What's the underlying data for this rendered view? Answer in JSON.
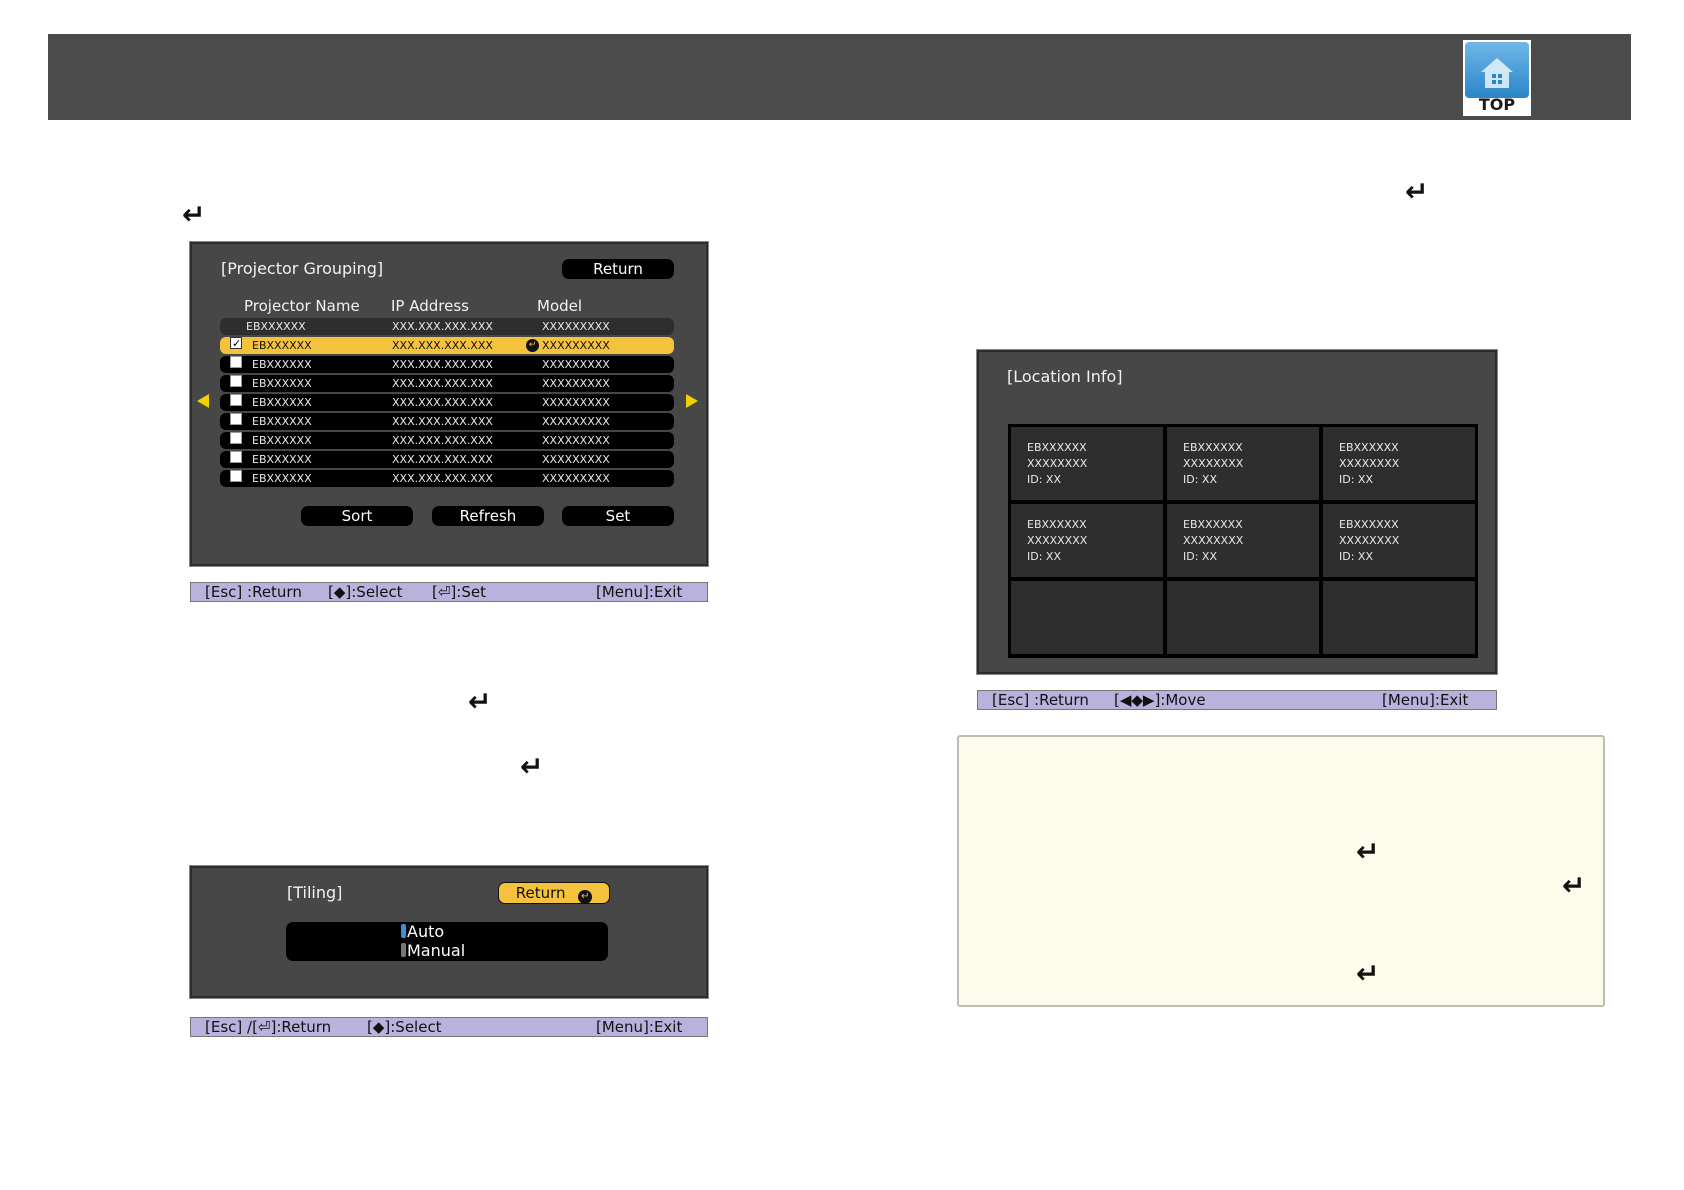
{
  "header": {
    "logo_label": "TOP"
  },
  "projector_grouping": {
    "title": "[Projector Grouping]",
    "return_label": "Return",
    "columns": [
      "Projector Name",
      "IP Address",
      "Model"
    ],
    "rows": [
      {
        "name": "EBXXXXXX",
        "ip": "XXX.XXX.XXX.XXX",
        "model": "XXXXXXXXX",
        "checked": false,
        "selected": false
      },
      {
        "name": "EBXXXXXX",
        "ip": "XXX.XXX.XXX.XXX",
        "model": "XXXXXXXXX",
        "checked": true,
        "selected": true
      },
      {
        "name": "EBXXXXXX",
        "ip": "XXX.XXX.XXX.XXX",
        "model": "XXXXXXXXX",
        "checked": false,
        "selected": false
      },
      {
        "name": "EBXXXXXX",
        "ip": "XXX.XXX.XXX.XXX",
        "model": "XXXXXXXXX",
        "checked": false,
        "selected": false
      },
      {
        "name": "EBXXXXXX",
        "ip": "XXX.XXX.XXX.XXX",
        "model": "XXXXXXXXX",
        "checked": false,
        "selected": false
      },
      {
        "name": "EBXXXXXX",
        "ip": "XXX.XXX.XXX.XXX",
        "model": "XXXXXXXXX",
        "checked": false,
        "selected": false
      },
      {
        "name": "EBXXXXXX",
        "ip": "XXX.XXX.XXX.XXX",
        "model": "XXXXXXXXX",
        "checked": false,
        "selected": false
      },
      {
        "name": "EBXXXXXX",
        "ip": "XXX.XXX.XXX.XXX",
        "model": "XXXXXXXXX",
        "checked": false,
        "selected": false
      },
      {
        "name": "EBXXXXXX",
        "ip": "XXX.XXX.XXX.XXX",
        "model": "XXXXXXXXX",
        "checked": false,
        "selected": false
      }
    ],
    "sort_label": "Sort",
    "refresh_label": "Refresh",
    "set_label": "Set",
    "status": {
      "esc": "[Esc] :Return",
      "select": "[◆]:Select",
      "set": "[⏎]:Set",
      "menu": "[Menu]:Exit"
    }
  },
  "tiling": {
    "title": "[Tiling]",
    "return_label": "Return",
    "options": [
      "Auto",
      "Manual"
    ],
    "status": {
      "esc": "[Esc] /[⏎]:Return",
      "select": "[◆]:Select",
      "menu": "[Menu]:Exit"
    }
  },
  "location_info": {
    "title": "[Location Info]",
    "cells": [
      {
        "line1": "EBXXXXXX",
        "line2": "XXXXXXXX",
        "line3": "ID: XX"
      },
      {
        "line1": "EBXXXXXX",
        "line2": "XXXXXXXX",
        "line3": "ID: XX"
      },
      {
        "line1": "EBXXXXXX",
        "line2": "XXXXXXXX",
        "line3": "ID: XX"
      },
      {
        "line1": "EBXXXXXX",
        "line2": "XXXXXXXX",
        "line3": "ID: XX"
      },
      {
        "line1": "EBXXXXXX",
        "line2": "XXXXXXXX",
        "line3": "ID: XX"
      },
      {
        "line1": "EBXXXXXX",
        "line2": "XXXXXXXX",
        "line3": "ID: XX"
      },
      {
        "line1": "",
        "line2": "",
        "line3": ""
      },
      {
        "line1": "",
        "line2": "",
        "line3": ""
      },
      {
        "line1": "",
        "line2": "",
        "line3": ""
      }
    ],
    "status": {
      "esc": "[Esc] :Return",
      "move": "[◀◆▶]:Move",
      "menu": "[Menu]:Exit"
    }
  },
  "icons": {
    "enter": "↵"
  },
  "colors": {
    "header_bar": "#4b4b4b",
    "panel_bg": "#474747",
    "highlight": "#f5c23d",
    "status_bar": "#b8b2dd",
    "note_bg": "#fdfbea"
  }
}
